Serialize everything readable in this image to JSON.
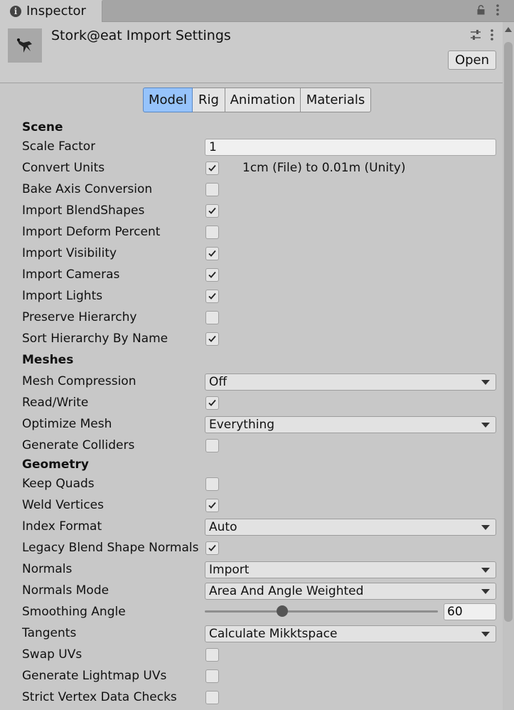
{
  "tab": {
    "title": "Inspector"
  },
  "header": {
    "title": "Stork@eat Import Settings",
    "open_label": "Open"
  },
  "toolbar": {
    "tabs": [
      "Model",
      "Rig",
      "Animation",
      "Materials"
    ],
    "active": "Model"
  },
  "sections": {
    "scene": "Scene",
    "meshes": "Meshes",
    "geometry": "Geometry"
  },
  "scene": {
    "scale_factor": {
      "label": "Scale Factor",
      "value": "1"
    },
    "convert_units": {
      "label": "Convert Units",
      "checked": true,
      "note": "1cm (File) to 0.01m (Unity)"
    },
    "bake_axis": {
      "label": "Bake Axis Conversion",
      "checked": false
    },
    "blendshapes": {
      "label": "Import BlendShapes",
      "checked": true
    },
    "deform_percent": {
      "label": "Import Deform Percent",
      "checked": false
    },
    "visibility": {
      "label": "Import Visibility",
      "checked": true
    },
    "cameras": {
      "label": "Import Cameras",
      "checked": true
    },
    "lights": {
      "label": "Import Lights",
      "checked": true
    },
    "preserve_hierarchy": {
      "label": "Preserve Hierarchy",
      "checked": false
    },
    "sort_hierarchy": {
      "label": "Sort Hierarchy By Name",
      "checked": true
    }
  },
  "meshes": {
    "compression": {
      "label": "Mesh Compression",
      "value": "Off"
    },
    "read_write": {
      "label": "Read/Write",
      "checked": true
    },
    "optimize": {
      "label": "Optimize Mesh",
      "value": "Everything"
    },
    "colliders": {
      "label": "Generate Colliders",
      "checked": false
    }
  },
  "geometry": {
    "keep_quads": {
      "label": "Keep Quads",
      "checked": false
    },
    "weld_vertices": {
      "label": "Weld Vertices",
      "checked": true
    },
    "index_format": {
      "label": "Index Format",
      "value": "Auto"
    },
    "legacy_blend": {
      "label": "Legacy Blend Shape Normals",
      "checked": true
    },
    "normals": {
      "label": "Normals",
      "value": "Import"
    },
    "normals_mode": {
      "label": "Normals Mode",
      "value": "Area And Angle Weighted"
    },
    "smoothing_angle": {
      "label": "Smoothing Angle",
      "value": "60",
      "fraction": 0.333
    },
    "tangents": {
      "label": "Tangents",
      "value": "Calculate Mikktspace"
    },
    "swap_uvs": {
      "label": "Swap UVs",
      "checked": false
    },
    "lightmap_uvs": {
      "label": "Generate Lightmap UVs",
      "checked": false
    },
    "strict_vertex": {
      "label": "Strict Vertex Data Checks",
      "checked": false
    }
  }
}
